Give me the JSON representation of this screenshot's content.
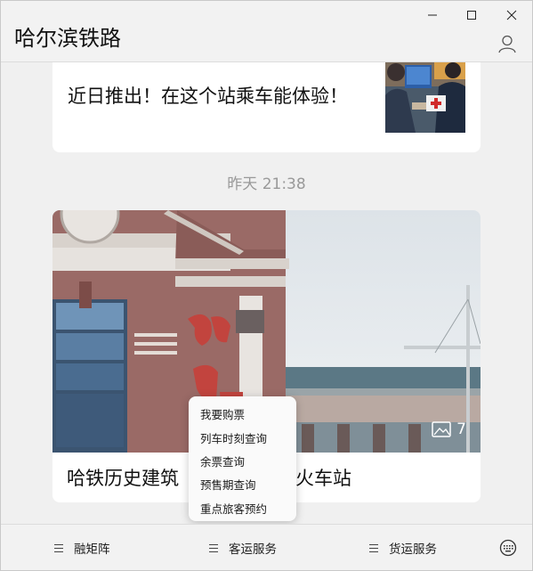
{
  "app": {
    "title": "哈尔滨铁路"
  },
  "feed": {
    "card1": {
      "text": "近日推出！在这个站乘车能体验！"
    },
    "timestamp": "昨天 21:38",
    "card2": {
      "title_left": "哈铁历史建筑",
      "title_right": "江火车站",
      "image_count": "7"
    }
  },
  "popup_menu": {
    "items": [
      "我要购票",
      "列车时刻查询",
      "余票查询",
      "预售期查询",
      "重点旅客预约"
    ]
  },
  "bottom_menu": {
    "items": [
      "融矩阵",
      "客运服务",
      "货运服务"
    ]
  },
  "icons": {
    "minimize": "minimize-icon",
    "maximize": "maximize-icon",
    "close": "close-icon",
    "user": "user-icon",
    "image": "image-icon",
    "menu": "hamburger-icon",
    "keyboard": "keyboard-icon"
  }
}
